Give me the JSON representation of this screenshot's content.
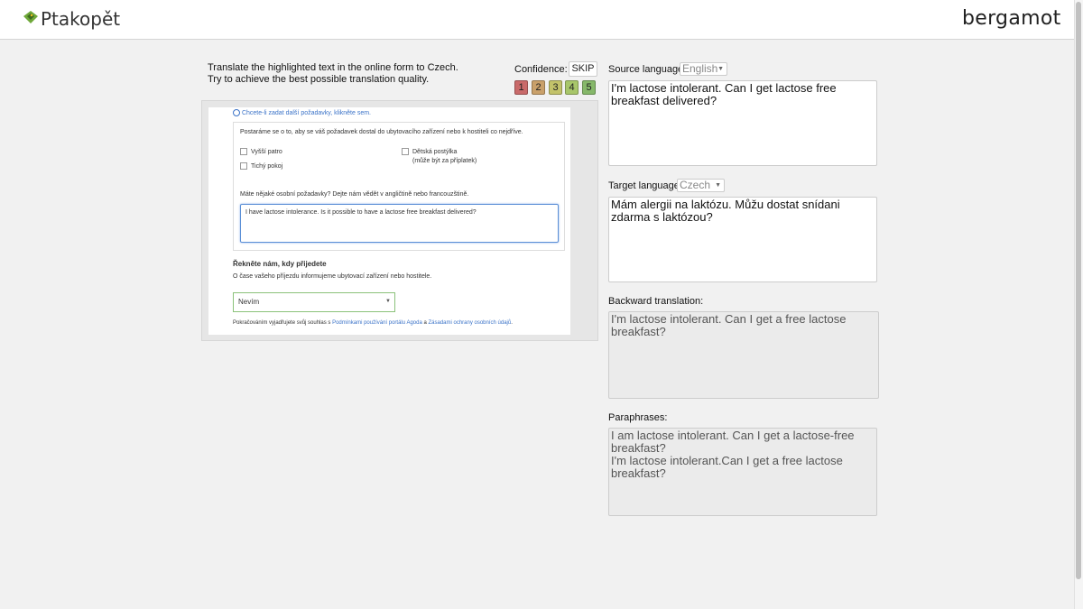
{
  "header": {
    "app_name": "Ptakopět",
    "brand_right": "bergamot"
  },
  "instructions": {
    "line1": "Translate the highlighted text in the online form to Czech.",
    "line2": "Try to achieve the best possible translation quality."
  },
  "confidence": {
    "label": "Confidence:",
    "skip": "SKIP",
    "levels": [
      "1",
      "2",
      "3",
      "4",
      "5"
    ],
    "colors": [
      "#c96a6a",
      "#c9a06a",
      "#c2c26a",
      "#a8c66a",
      "#86b86a"
    ]
  },
  "preview": {
    "more_requests_link": "Chcete-li zadat další požadavky, klikněte sem.",
    "notice": "Postaráme se o to, aby se váš požadavek dostal do ubytovacího zařízení nebo k hostiteli co nejdříve.",
    "opt_higher_floor": "Vyšší patro",
    "opt_quiet_room": "Tichý pokoj",
    "opt_crib": "Dětská postýlka",
    "opt_crib_note": "(může být za příplatek)",
    "personal_req_label": "Máte nějaké osobní požadavky? Dejte nám vědět v angličtině nebo francouzštině.",
    "personal_req_value": "I have lactose intolerance. Is it possible to have a lactose free breakfast delivered?",
    "arrival_heading": "Řekněte nám, kdy přijedete",
    "arrival_note": "O čase vašeho příjezdu informujeme ubytovací zařízení nebo hostitele.",
    "arrival_value": "Nevím",
    "consent_prefix": "Pokračováním vyjadřujete svůj souhlas s",
    "consent_link1": "Podmínkami používání portálu Agoda",
    "consent_and": "a",
    "consent_link2": "Zásadami ochrany osobních údajů",
    "consent_suffix": "."
  },
  "source": {
    "label": "Source language:",
    "language": "English",
    "text": "I'm lactose intolerant. Can I get lactose free breakfast delivered?"
  },
  "target": {
    "label": "Target language:",
    "language": "Czech",
    "text": "Mám alergii na laktózu. Můžu dostat snídani zdarma s laktózou?"
  },
  "backward": {
    "label": "Backward translation:",
    "text": "I'm lactose intolerant. Can I get a free lactose breakfast?"
  },
  "paraphrases": {
    "label": "Paraphrases:",
    "text": "I am lactose intolerant. Can I get a lactose-free breakfast?\nI'm lactose intolerant.Can I get a free lactose breakfast?"
  }
}
